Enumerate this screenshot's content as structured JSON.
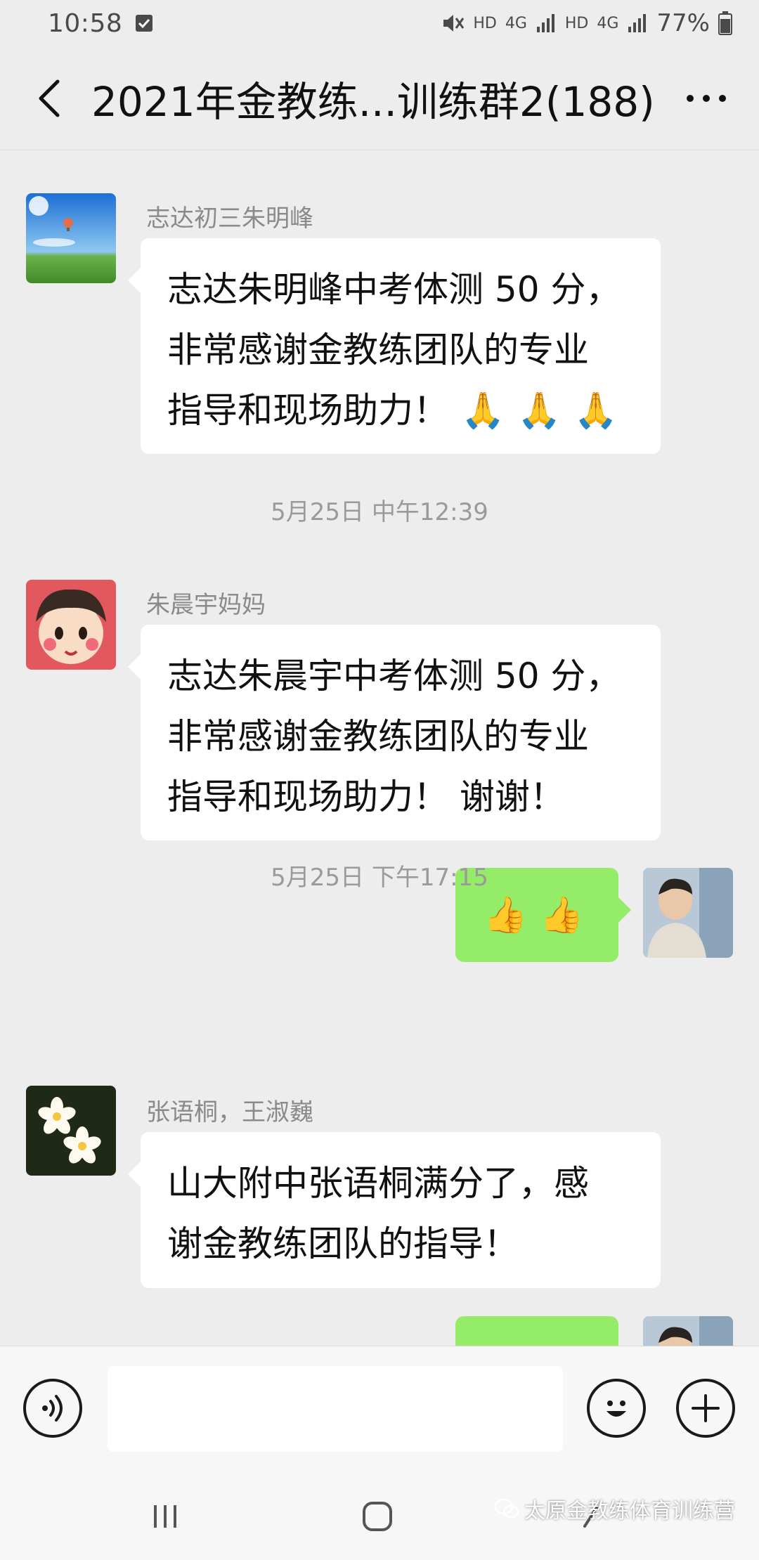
{
  "status_bar": {
    "time": "10:58",
    "battery": "77%",
    "hd1": "HD",
    "net1": "4G",
    "hd2": "HD",
    "net2": "4G"
  },
  "header": {
    "title": "2021年金教练...训练群2(188)"
  },
  "messages": [
    {
      "sender": "志达初三朱明峰",
      "lines": [
        "志达朱明峰中考体测 50 分，",
        "非常感谢金教练团队的专业",
        "指导和现场助力！"
      ],
      "emoji": "🙏",
      "emoji_count": 3
    },
    {
      "time": "5月25日 中午12:39"
    },
    {
      "sender": "朱晨宇妈妈",
      "lines": [
        "志达朱晨宇中考体测 50 分，",
        "非常感谢金教练团队的专业",
        "指导和现场助力！ 谢谢！"
      ]
    },
    {
      "outgoing_emoji": "👍",
      "outgoing_count": 2
    },
    {
      "time": "5月25日 下午17:15"
    },
    {
      "sender": "张语桐，王淑巍",
      "lines": [
        "山大附中张语桐满分了，感",
        "谢金教练团队的指导！"
      ]
    }
  ],
  "watermark": "太原金教练体育训练营",
  "colors": {
    "background": "#ededed",
    "outgoing_bubble": "#95ec69",
    "incoming_bubble": "#ffffff"
  }
}
